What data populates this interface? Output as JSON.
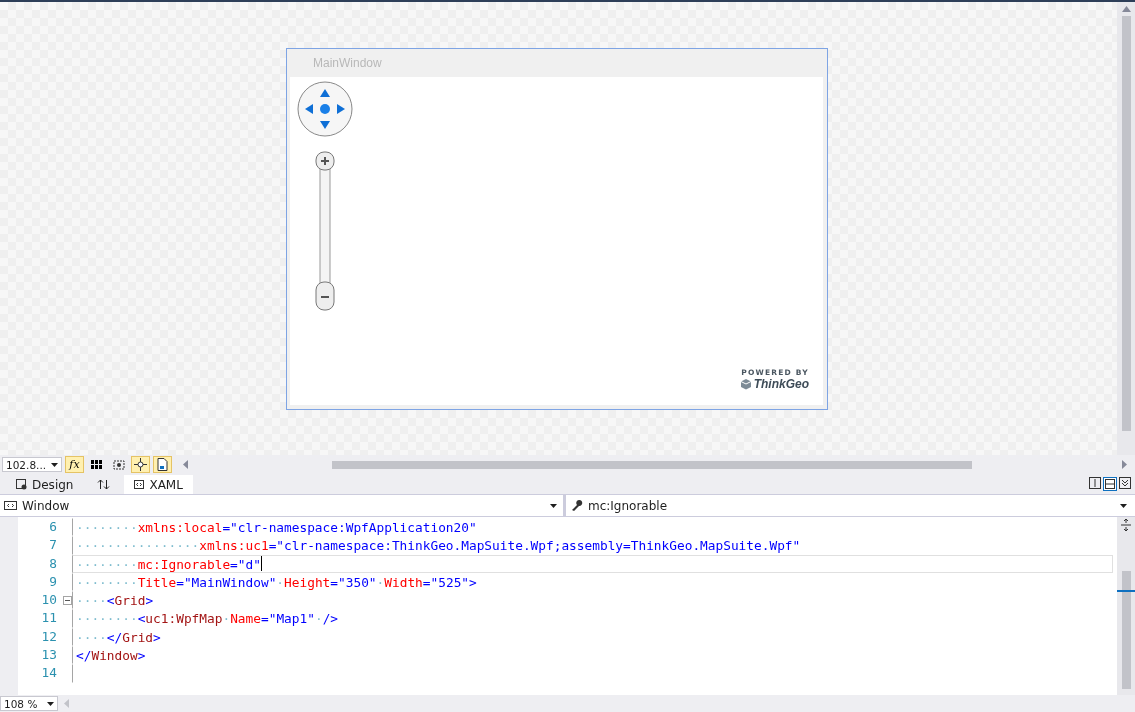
{
  "designer": {
    "window_title": "MainWindow",
    "logo_caption": "POWERED BY",
    "logo_name": "ThinkGeo"
  },
  "toolbar": {
    "zoom": "102.8...",
    "buttons": [
      {
        "kind": "fx",
        "label": "fx",
        "on": true
      },
      {
        "kind": "grid",
        "on": false
      },
      {
        "kind": "snap",
        "on": false
      },
      {
        "kind": "lines",
        "on": true
      },
      {
        "kind": "code",
        "on": true
      }
    ]
  },
  "tabs": [
    {
      "label": "Design",
      "selected": false,
      "kind": "design"
    },
    {
      "kind": "swap",
      "selected": false
    },
    {
      "label": "XAML",
      "selected": true,
      "kind": "xaml"
    }
  ],
  "nav": {
    "element": "Window",
    "member": "mc:Ignorable"
  },
  "code_lines": [
    {
      "number": "6",
      "current": false,
      "tokens": [
        {
          "kind": "ws",
          "text": "········"
        },
        {
          "kind": "attr",
          "text": "xmlns:local"
        },
        {
          "kind": "punct",
          "text": "="
        },
        {
          "kind": "value",
          "text": "\"clr-namespace:WpfApplication20\""
        }
      ]
    },
    {
      "number": "7",
      "current": false,
      "tokens": [
        {
          "kind": "ws",
          "text": "················"
        },
        {
          "kind": "attr",
          "text": "xmlns:uc1"
        },
        {
          "kind": "punct",
          "text": "="
        },
        {
          "kind": "value",
          "text": "\"clr-namespace:ThinkGeo.MapSuite.Wpf;assembly=ThinkGeo.MapSuite.Wpf\""
        }
      ]
    },
    {
      "number": "8",
      "current": true,
      "tokens": [
        {
          "kind": "ws",
          "text": "········"
        },
        {
          "kind": "attr",
          "text": "mc:Ignorable"
        },
        {
          "kind": "punct",
          "text": "="
        },
        {
          "kind": "value",
          "text": "\"d\""
        }
      ]
    },
    {
      "number": "9",
      "current": false,
      "tokens": [
        {
          "kind": "ws",
          "text": "········"
        },
        {
          "kind": "attr",
          "text": "Title"
        },
        {
          "kind": "punct",
          "text": "="
        },
        {
          "kind": "value",
          "text": "\"MainWindow\""
        },
        {
          "kind": "ws",
          "text": "·"
        },
        {
          "kind": "attr",
          "text": "Height"
        },
        {
          "kind": "punct",
          "text": "="
        },
        {
          "kind": "value",
          "text": "\"350\""
        },
        {
          "kind": "ws",
          "text": "·"
        },
        {
          "kind": "attr",
          "text": "Width"
        },
        {
          "kind": "punct",
          "text": "="
        },
        {
          "kind": "value",
          "text": "\"525\""
        },
        {
          "kind": "punct",
          "text": ">"
        }
      ]
    },
    {
      "number": "10",
      "current": false,
      "fold": true,
      "tokens": [
        {
          "kind": "ws",
          "text": "····"
        },
        {
          "kind": "punct",
          "text": "<"
        },
        {
          "kind": "tag",
          "text": "Grid"
        },
        {
          "kind": "punct",
          "text": ">"
        }
      ]
    },
    {
      "number": "11",
      "current": false,
      "tokens": [
        {
          "kind": "ws",
          "text": "········"
        },
        {
          "kind": "punct",
          "text": "<"
        },
        {
          "kind": "tag",
          "text": "uc1:WpfMap"
        },
        {
          "kind": "ws",
          "text": "·"
        },
        {
          "kind": "attr",
          "text": "Name"
        },
        {
          "kind": "punct",
          "text": "="
        },
        {
          "kind": "value",
          "text": "\"Map1\""
        },
        {
          "kind": "ws",
          "text": "·"
        },
        {
          "kind": "punct",
          "text": "/>"
        }
      ]
    },
    {
      "number": "12",
      "current": false,
      "tokens": [
        {
          "kind": "ws",
          "text": "····"
        },
        {
          "kind": "punct",
          "text": "</"
        },
        {
          "kind": "tag",
          "text": "Grid"
        },
        {
          "kind": "punct",
          "text": ">"
        }
      ]
    },
    {
      "number": "13",
      "current": false,
      "tokens": [
        {
          "kind": "punct",
          "text": "</"
        },
        {
          "kind": "tag",
          "text": "Window"
        },
        {
          "kind": "punct",
          "text": ">"
        }
      ]
    },
    {
      "number": "14",
      "current": false
    }
  ],
  "editor_zoom": "108 %"
}
